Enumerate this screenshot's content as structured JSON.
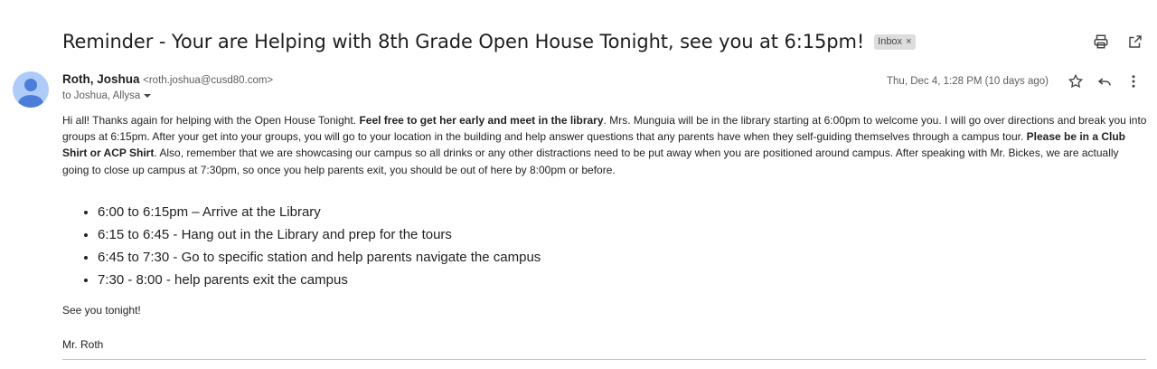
{
  "email": {
    "subject": "Reminder - Your are Helping with 8th Grade Open House Tonight, see you at 6:15pm!",
    "label": "Inbox",
    "label_remove": "×",
    "sender_name": "Roth, Joshua",
    "sender_email": "<roth.joshua@cusd80.com>",
    "recipients": "to Joshua, Allysa",
    "date": "Thu, Dec 4, 1:28 PM (10 days ago)",
    "body": {
      "p1_a": "Hi all! Thanks again for helping with the Open House Tonight. ",
      "p1_bold1": "Feel free to get her early and meet in the library",
      "p1_b": ". Mrs. Munguia will be in the library starting at 6:00pm to welcome you. I will go over directions and break you into groups at 6:15pm. After your get into your groups, you will go to your location in the building and help answer questions that any parents have when they self-guiding themselves through a campus tour. ",
      "p1_bold2": "Please be in a Club Shirt or ACP Shirt",
      "p1_c": ". Also, remember that we are showcasing our campus so all drinks or any other distractions need to be put away when you are positioned around campus. After speaking with Mr. Bickes, we are actually going to close up campus at 7:30pm, so once you help parents exit, you should be out of here by 8:00pm or before.",
      "schedule": [
        "6:00 to 6:15pm – Arrive at the Library",
        "6:15 to 6:45 - Hang out in the Library and prep for the tours",
        "6:45 to 7:30 - Go to specific station and help parents navigate the campus",
        "7:30 - 8:00 - help parents exit the campus"
      ],
      "closing": "See you tonight!",
      "signature": "Mr. Roth"
    }
  },
  "icons": {
    "print": "print-icon",
    "open_new_window": "open-in-new-window-icon",
    "star": "star-icon",
    "reply": "reply-icon",
    "more": "more-vertical-icon",
    "expand_recipients": "chevron-down-icon",
    "avatar": "person-icon"
  },
  "colors": {
    "avatar_bg": "#aecbfa",
    "avatar_fg": "#4c7ed9",
    "label_bg": "#dddddd"
  }
}
